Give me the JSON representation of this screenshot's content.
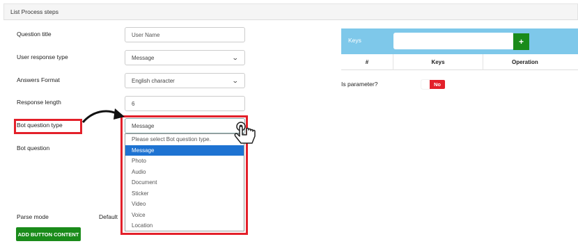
{
  "panel": {
    "title": "List Process steps"
  },
  "labels": {
    "question_title": "Question title",
    "user_response_type": "User response type",
    "answers_format": "Answers Format",
    "response_length": "Response length",
    "bot_question_type": "Bot question type",
    "bot_question": "Bot question",
    "parse_mode": "Parse mode",
    "default": "Default",
    "is_parameter": "Is parameter?"
  },
  "fields": {
    "question_title_placeholder": "User Name",
    "user_response_type_value": "Message",
    "answers_format_value": "English character",
    "response_length_value": "6",
    "bot_question_type_value": "Message"
  },
  "dropdown": {
    "options": [
      "Please select Bot question type.",
      "Message",
      "Photo",
      "Audio",
      "Document",
      "Sticker",
      "Video",
      "Voice",
      "Location"
    ],
    "selected": "Message"
  },
  "buttons": {
    "add_button_content": "ADD BUTTON CONTENT",
    "add_key": "+"
  },
  "keys": {
    "label": "Keys",
    "table_headers": [
      "#",
      "Keys",
      "Operation"
    ]
  },
  "toggle": {
    "state": "No"
  },
  "icons": {
    "select_chevron": "chevron-down-icon",
    "plus": "plus-icon",
    "pointer": "hand-pointer-icon",
    "arrow": "curved-arrow-icon"
  },
  "colors": {
    "annotation_red": "#e3202a",
    "primary_green": "#1a8b1a",
    "keys_bar": "#7ec8ea",
    "selected_blue": "#1e73d2"
  }
}
